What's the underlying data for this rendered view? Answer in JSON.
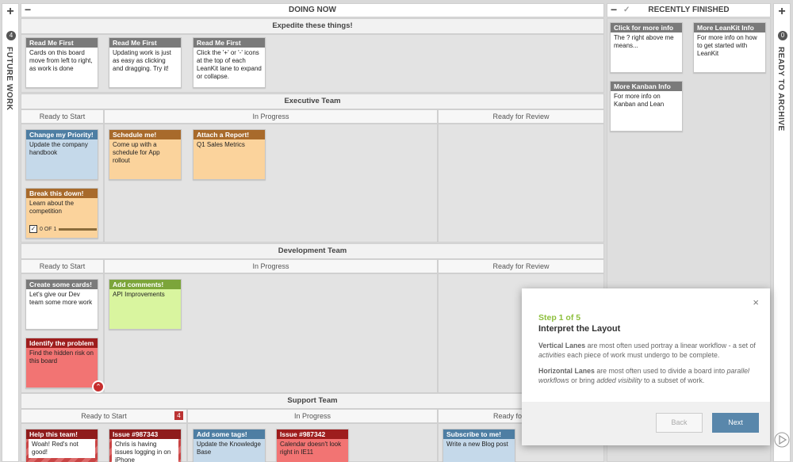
{
  "left_strip": {
    "add": "+",
    "count": "4",
    "label": "FUTURE WORK"
  },
  "right_strip": {
    "add": "+",
    "count": "0",
    "label": "READY TO ARCHIVE"
  },
  "doing_now": {
    "collapse": "−",
    "title": "DOING NOW"
  },
  "recently_finished": {
    "collapse": "−",
    "check": "✓",
    "title": "RECENTLY FINISHED"
  },
  "lanes": {
    "expedite": "Expedite these things!",
    "executive": "Executive Team",
    "development": "Development Team",
    "support": "Support Team"
  },
  "columns": {
    "ready": "Ready to Start",
    "progress": "In Progress",
    "review": "Ready for Review",
    "review_clipped": "Ready fo",
    "support_ready_count": "4"
  },
  "cards": {
    "rm1": {
      "title": "Read Me First",
      "body": "Cards on this board move from left to right, as work is done"
    },
    "rm2": {
      "title": "Read Me First",
      "body": "Updating work is just as easy as clicking and dragging. Try it!"
    },
    "rm3": {
      "title": "Read Me First",
      "body": "Click the '+' or '-' icons at the top of each LeanKit lane to expand or collapse."
    },
    "change": {
      "title": "Change my Priority!",
      "body": "Update the company handbook"
    },
    "schedule": {
      "title": "Schedule me!",
      "body": "Come up with a schedule for App rollout"
    },
    "report": {
      "title": "Attach a Report!",
      "body": "Q1 Sales Metrics"
    },
    "breakdown": {
      "title": "Break this down!",
      "body": "Learn about the competition",
      "progress": "0 OF 1"
    },
    "create": {
      "title": "Create some cards!",
      "body": "Let's give our Dev team some more work"
    },
    "comments": {
      "title": "Add comments!",
      "body": "API Improvements"
    },
    "identify": {
      "title": "Identify the problem",
      "body": "Find the hidden risk on this board"
    },
    "help": {
      "title": "Help this team!",
      "body": "Woah! Red's not good!"
    },
    "issue343": {
      "title": "Issue #987343",
      "body": "Chris is having issues logging in on iPhone"
    },
    "tags": {
      "title": "Add some tags!",
      "body": "Update the Knowledge Base"
    },
    "issue342": {
      "title": "Issue #987342",
      "body": "Calendar doesn't look right in IE11"
    },
    "subscribe": {
      "title": "Subscribe to me!",
      "body": "Write a new Blog post"
    },
    "clickinfo": {
      "title": "Click for more info",
      "body": "The ? right above me means..."
    },
    "moreleankit": {
      "title": "More LeanKit Info",
      "body": "For more info on how to get started with LeanKit"
    },
    "morekanban": {
      "title": "More Kanban Info",
      "body": "For more info on Kanban and Lean"
    }
  },
  "dialog": {
    "close": "×",
    "step": "Step 1 of 5",
    "title": "Interpret the Layout",
    "p1_strong": "Vertical Lanes",
    "p1_text": " are most often used portray a linear workflow - a set of ",
    "p1_em": "activities",
    "p1_tail": " each piece of work must undergo to be complete.",
    "p2_strong": "Horizontal Lanes",
    "p2_text": " are most often used to divide a board into ",
    "p2_em": "parallel workflows",
    "p2_mid": " or bring ",
    "p2_em2": "added visibility",
    "p2_tail": " to a subset of work.",
    "back": "Back",
    "next": "Next"
  },
  "colors": {
    "accent_green": "#8dbf3d",
    "next_button": "#5987ab",
    "risk_red": "#9e1d1d"
  }
}
